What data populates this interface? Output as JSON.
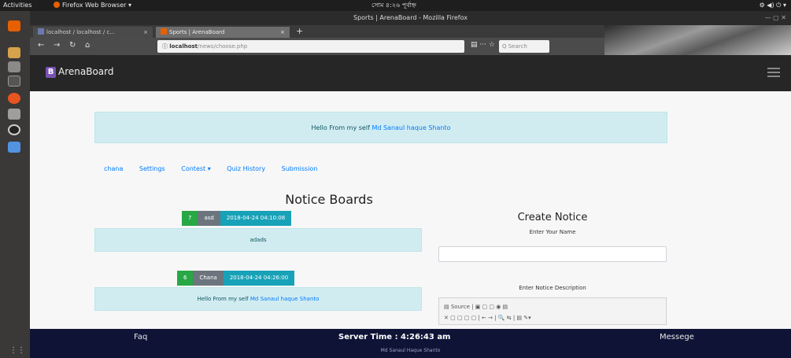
{
  "system": {
    "activities": "Activities",
    "app_menu": "Firefox Web Browser ▾",
    "clock": "সোম ৪:২৬ পূর্বাহ্ন",
    "tray": "⚙ ◀) ⏻ ▾"
  },
  "browser": {
    "window_title": "Sports | ArenaBoard - Mozilla Firefox",
    "tabs": [
      {
        "label": "localhost / localhost / c...",
        "close": "×"
      },
      {
        "label": "Sports | ArenaBoard",
        "close": "×"
      }
    ],
    "new_tab": "+",
    "url_host": "localhost",
    "url_path": "/news/choose.php",
    "page_actions": "▤  ··· ☆",
    "search_placeholder": "Q Search"
  },
  "site": {
    "brand_letter": "B",
    "brand_name": "ArenaBoard"
  },
  "greeting": {
    "prefix": "Hello From my self ",
    "name": "Md Sanaul haque Shanto"
  },
  "nav": {
    "items": [
      "chana",
      "Settings",
      "Contest ▾",
      "Quiz History",
      "Submission"
    ]
  },
  "notice_board": {
    "title": "Notice Boards",
    "notices": [
      {
        "id": "7",
        "author": "asd",
        "date": "2018-04-24 04:10:08",
        "text": "adads",
        "link": ""
      },
      {
        "id": "6",
        "author": "Chana",
        "date": "2018-04-24 04:26:00",
        "text": "Hello From my self ",
        "link": "Md Sanaul haque Shanto"
      }
    ]
  },
  "create_notice": {
    "title": "Create Notice",
    "name_label": "Enter Your Name",
    "name_value": "",
    "desc_label": "Enter Notice Description",
    "toolbar_row1": "▤ Source  |  ▣  ▢  ▢  ◉  ▤",
    "toolbar_row2": "✕  ▢  ▢  ▢  ▢  |  ←  →  |  🔍  ⇆  |  ▤  ✎▾"
  },
  "footer": {
    "faq": "Faq",
    "server_time": "Server Time : 4:26:43 am",
    "message": "Messege",
    "credit": "Md Sanaul Haque Shanto"
  }
}
